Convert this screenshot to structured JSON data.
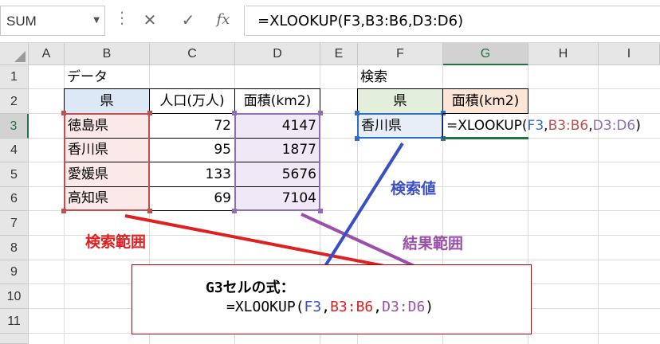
{
  "formula_bar": {
    "name_box": "SUM",
    "cancel_icon": "✕",
    "enter_icon": "✓",
    "fx_icon": "fx",
    "formula": "=XLOOKUP(F3,B3:B6,D3:D6)"
  },
  "columns": [
    "A",
    "B",
    "C",
    "D",
    "E",
    "F",
    "G",
    "H",
    "I"
  ],
  "rows": [
    "1",
    "2",
    "3",
    "4",
    "5",
    "6",
    "7",
    "8",
    "9",
    "10",
    "11"
  ],
  "cells": {
    "B1": "データ",
    "F1": "検索",
    "B2": "県",
    "C2": "人口(万人)",
    "D2": "面積(km2)",
    "F2": "県",
    "G2": "面積(km2)",
    "data": [
      {
        "pref": "徳島県",
        "pop": "72",
        "area": "4147"
      },
      {
        "pref": "香川県",
        "pop": "95",
        "area": "1877"
      },
      {
        "pref": "愛媛県",
        "pop": "133",
        "area": "5676"
      },
      {
        "pref": "高知県",
        "pop": "69",
        "area": "7104"
      }
    ],
    "F3": "香川県",
    "G3_prefix": "=XLOOKUP(",
    "G3_arg1": "F3",
    "G3_comma1": ",",
    "G3_arg2": "B3:B6",
    "G3_comma2": ",",
    "G3_arg3": "D3:D6",
    "G3_suffix": ")"
  },
  "annotations": {
    "search_value": "検索値",
    "search_range": "検索範囲",
    "result_range": "結果範囲"
  },
  "callout": {
    "line1": "G3セルの式：",
    "prefix": "=XLOOKUP(",
    "arg1": "F3",
    "comma1": ",",
    "arg2": "B3:B6",
    "comma2": ",",
    "arg3": "D3:D6",
    "suffix": ")"
  },
  "colors": {
    "red": "#e02020",
    "blue": "#3a4fc4",
    "purple": "#9b4fa8",
    "excel_green": "#217346"
  }
}
